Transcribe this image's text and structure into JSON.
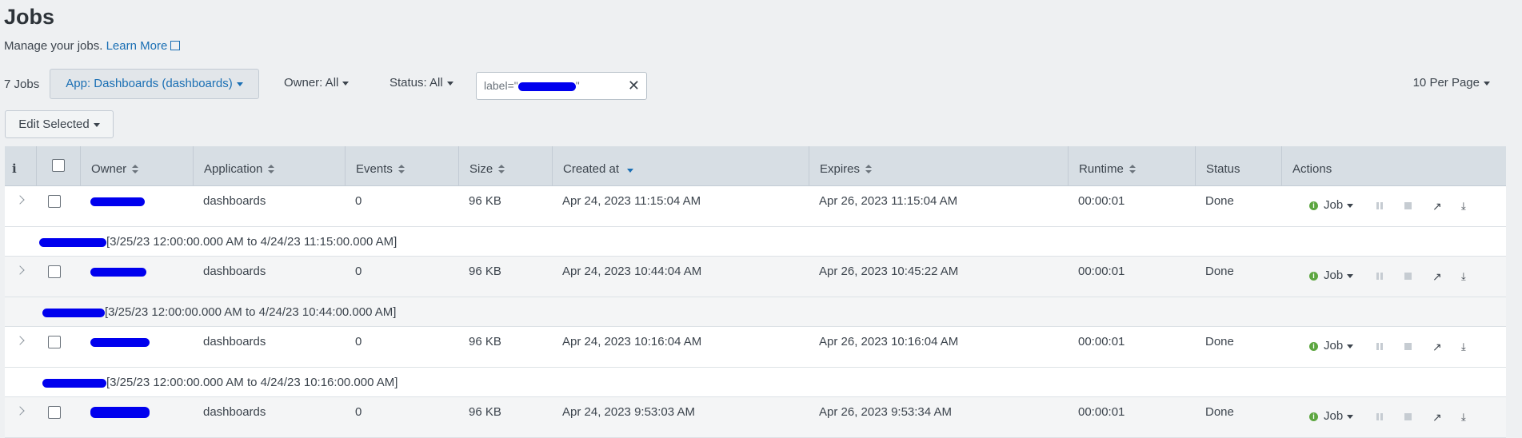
{
  "page": {
    "title": "Jobs",
    "subtitle": "Manage your jobs.",
    "learn_more": "Learn More"
  },
  "toolbar": {
    "count": "7 Jobs",
    "app_filter": "App: Dashboards (dashboards)",
    "owner_filter": "Owner: All",
    "status_filter": "Status: All",
    "search_value_prefix": "label=\"",
    "search_value_suffix": "\"",
    "per_page": "10 Per Page",
    "edit_selected": "Edit Selected"
  },
  "table": {
    "columns": {
      "info": "i",
      "owner": "Owner",
      "application": "Application",
      "events": "Events",
      "size": "Size",
      "created": "Created at",
      "expires": "Expires",
      "runtime": "Runtime",
      "status": "Status",
      "actions": "Actions"
    },
    "rows": [
      {
        "application": "dashboards",
        "events": "0",
        "size": "96 KB",
        "created": "Apr 24, 2023 11:15:04 AM",
        "expires": "Apr 26, 2023 11:15:04 AM",
        "runtime": "00:00:01",
        "status": "Done",
        "job": "Job",
        "description": "[3/25/23 12:00:00.000 AM to 4/24/23 11:15:00.000 AM]"
      },
      {
        "application": "dashboards",
        "events": "0",
        "size": "96 KB",
        "created": "Apr 24, 2023 10:44:04 AM",
        "expires": "Apr 26, 2023 10:45:22 AM",
        "runtime": "00:00:01",
        "status": "Done",
        "job": "Job",
        "description": "[3/25/23 12:00:00.000 AM to 4/24/23 10:44:00.000 AM]"
      },
      {
        "application": "dashboards",
        "events": "0",
        "size": "96 KB",
        "created": "Apr 24, 2023 10:16:04 AM",
        "expires": "Apr 26, 2023 10:16:04 AM",
        "runtime": "00:00:01",
        "status": "Done",
        "job": "Job",
        "description": "[3/25/23 12:00:00.000 AM to 4/24/23 10:16:00.000 AM]"
      },
      {
        "application": "dashboards",
        "events": "0",
        "size": "96 KB",
        "created": "Apr 24, 2023 9:53:03 AM",
        "expires": "Apr 26, 2023 9:53:34 AM",
        "runtime": "00:00:01",
        "status": "Done",
        "job": "Job"
      }
    ]
  },
  "colors": {
    "link": "#1a6fb4",
    "header_bg": "#d7dee4",
    "redaction": "#0000ee",
    "done_icon": "#5ca640"
  }
}
